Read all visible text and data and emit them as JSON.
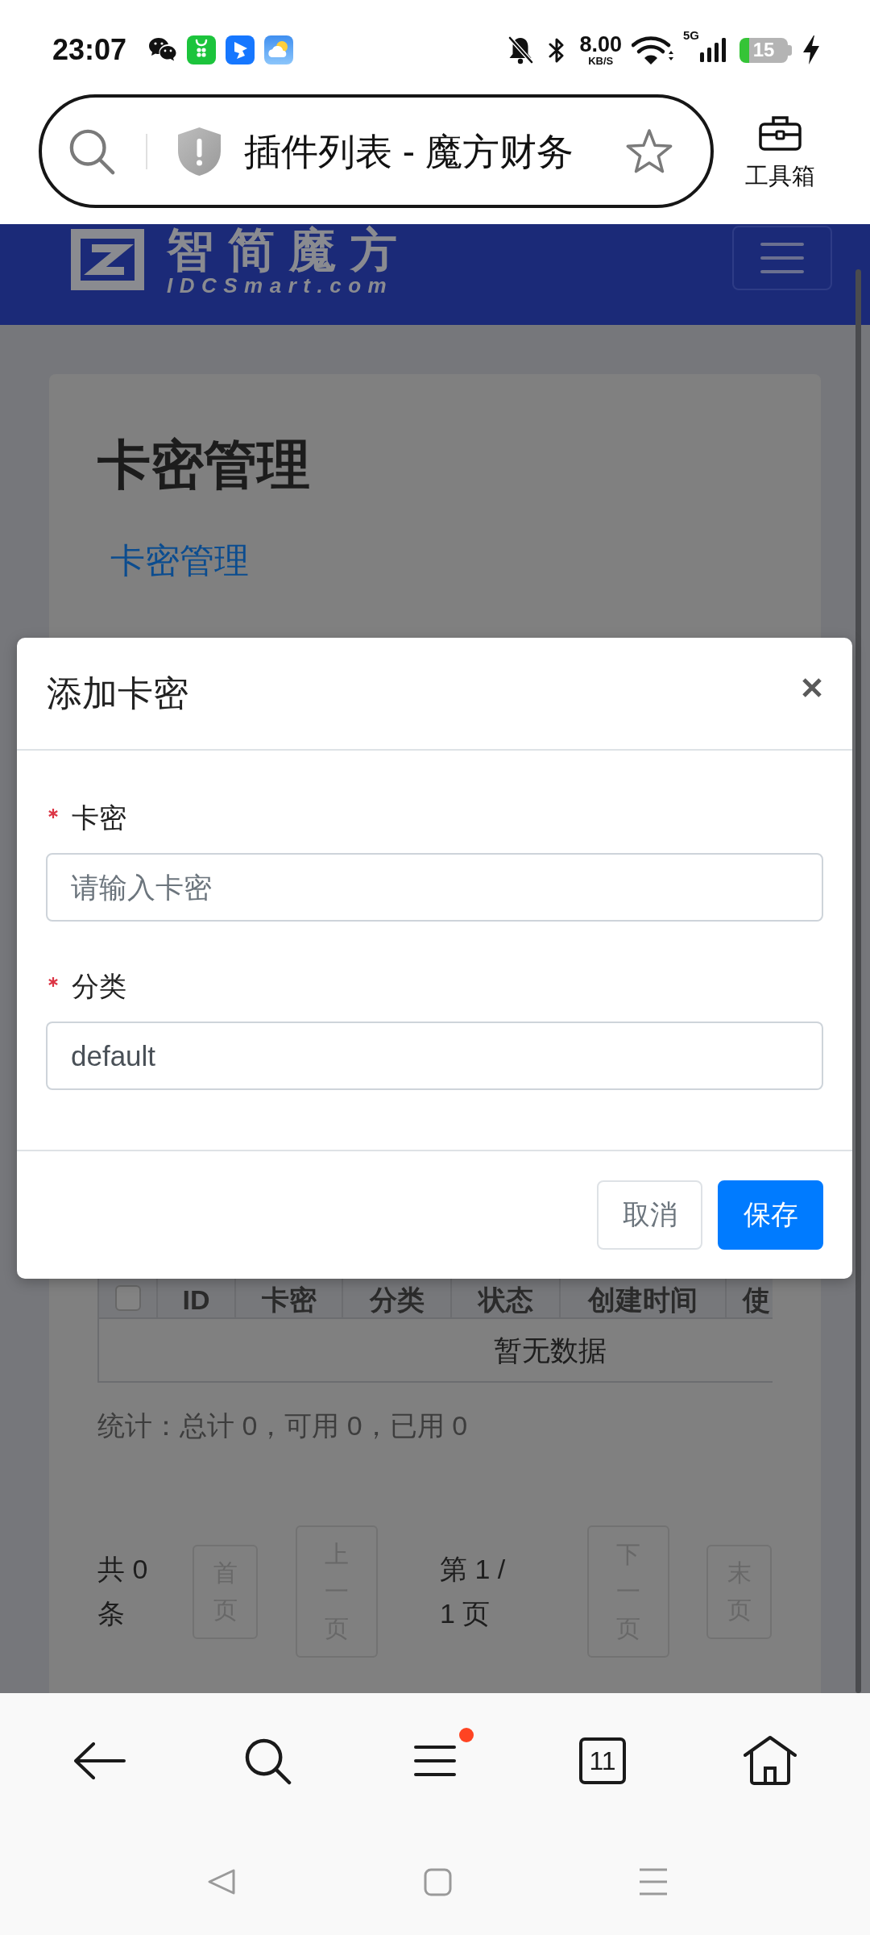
{
  "status_bar": {
    "time": "23:07",
    "speed": "8.00",
    "speed_unit": "KB/S",
    "network": "5G",
    "battery": "15"
  },
  "browser": {
    "page_title": "插件列表 - 魔方财务",
    "toolbox": "工具箱"
  },
  "site_header": {
    "logo_text": "智简魔方",
    "logo_domain": "IDCSmart.com"
  },
  "page": {
    "title": "卡密管理",
    "tab": "卡密管理",
    "table": {
      "select_all_checked": false,
      "columns": [
        "ID",
        "卡密",
        "分类",
        "状态",
        "创建时间",
        "使"
      ],
      "empty_text": "暂无数据"
    },
    "stats": "统计：总计 0，可用 0，已用 0",
    "pagination": {
      "total": "共 0 条",
      "first": {
        "label": "首页",
        "disabled": true
      },
      "prev": {
        "label": "上一页",
        "disabled": true
      },
      "page_info": "第 1 / 1 页",
      "next": {
        "label": "下一页",
        "disabled": true
      },
      "last": {
        "label": "末页",
        "disabled": true
      }
    }
  },
  "dialog": {
    "title": "添加卡密",
    "fields": [
      {
        "label": "卡密",
        "required": true,
        "placeholder": "请输入卡密"
      },
      {
        "label": "分类",
        "required": true,
        "value": "default"
      }
    ],
    "buttons": [
      {
        "label": "取消",
        "kind": "secondary"
      },
      {
        "label": "保存",
        "kind": "primary"
      }
    ]
  },
  "bottom_bar": {
    "tab_count": "11",
    "menu_badge": true
  }
}
